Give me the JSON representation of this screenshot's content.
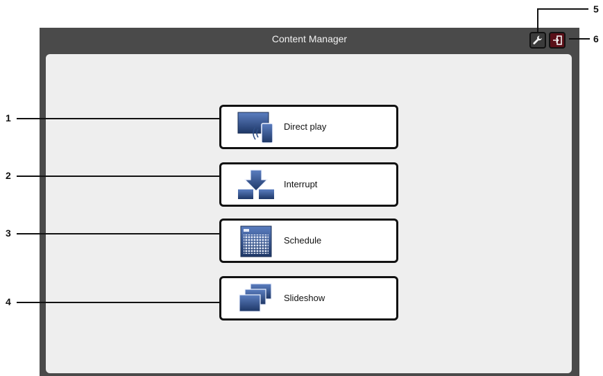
{
  "app": {
    "title": "Content Manager"
  },
  "toolbar": {
    "settings_icon": "wrench-icon",
    "exit_icon": "exit-icon"
  },
  "menu": [
    {
      "label": "Direct play",
      "icon": "direct-play-icon"
    },
    {
      "label": "Interrupt",
      "icon": "interrupt-icon"
    },
    {
      "label": "Schedule",
      "icon": "schedule-icon"
    },
    {
      "label": "Slideshow",
      "icon": "slideshow-icon"
    }
  ],
  "callouts": [
    "1",
    "2",
    "3",
    "4",
    "5",
    "6"
  ],
  "colors": {
    "frame": "#4a4a4a",
    "panel": "#eeeeee",
    "icon_blue": "#2f4f86",
    "exit_red": "#5a1018"
  }
}
